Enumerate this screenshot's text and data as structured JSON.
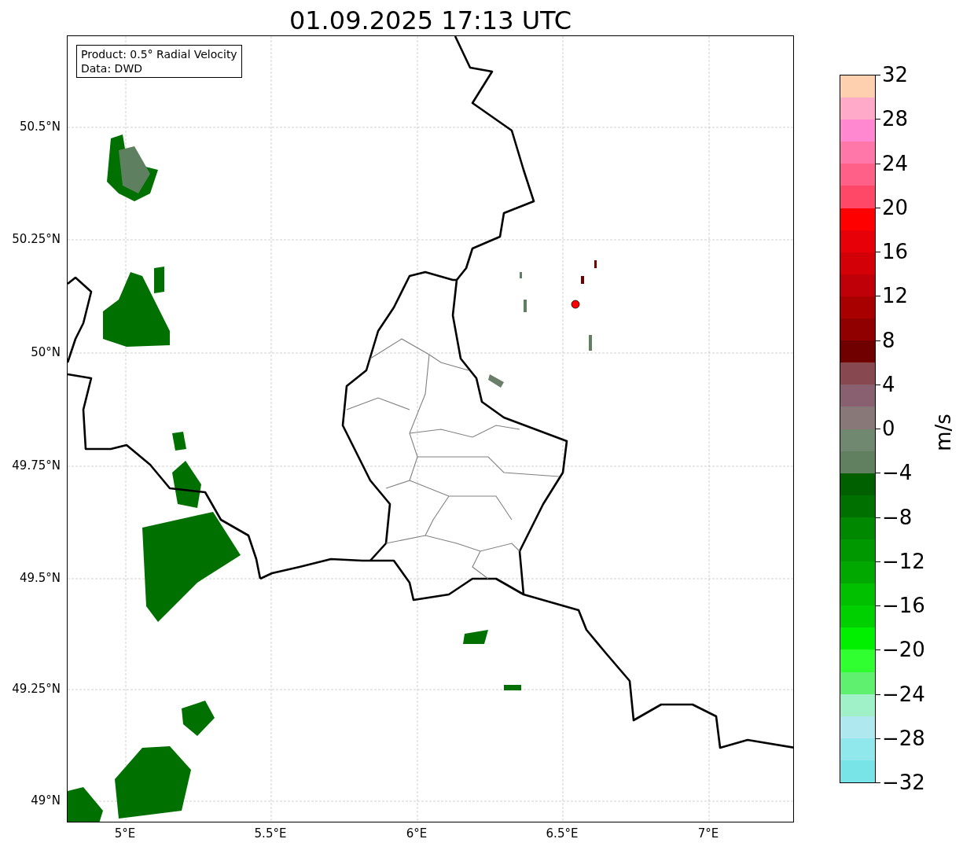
{
  "title": "01.09.2025 17:13 UTC",
  "info_box": [
    "Product: 0.5° Radial Velocity",
    "Data: DWD"
  ],
  "lat_labels": [
    "50.5°N",
    "50.25°N",
    "50°N",
    "49.75°N",
    "49.5°N",
    "49.25°N",
    "49°N"
  ],
  "lon_labels": [
    "5°E",
    "5.5°E",
    "6°E",
    "6.5°E",
    "7°E"
  ],
  "colorbar": {
    "label": "m/s",
    "ticks": [
      "32",
      "28",
      "24",
      "20",
      "16",
      "12",
      "8",
      "4",
      "0",
      "−4",
      "−8",
      "−12",
      "−16",
      "−20",
      "−24",
      "−28",
      "−32"
    ],
    "segments": [
      {
        "color": "#ffd0b0"
      },
      {
        "color": "#ffaac8"
      },
      {
        "color": "#ff88d0"
      },
      {
        "color": "#ff77a8"
      },
      {
        "color": "#ff6088"
      },
      {
        "color": "#ff4868"
      },
      {
        "color": "#ff0000"
      },
      {
        "color": "#e80008"
      },
      {
        "color": "#d40008"
      },
      {
        "color": "#c00008"
      },
      {
        "color": "#a80000"
      },
      {
        "color": "#900000"
      },
      {
        "color": "#700000"
      },
      {
        "color": "#884850"
      },
      {
        "color": "#886070"
      },
      {
        "color": "#887878"
      },
      {
        "color": "#708870"
      },
      {
        "color": "#608060"
      },
      {
        "color": "#006000"
      },
      {
        "color": "#007000"
      },
      {
        "color": "#008800"
      },
      {
        "color": "#009800"
      },
      {
        "color": "#00a800"
      },
      {
        "color": "#00c000"
      },
      {
        "color": "#00d000"
      },
      {
        "color": "#00f000"
      },
      {
        "color": "#30ff30"
      },
      {
        "color": "#60f070"
      },
      {
        "color": "#a0f0c8"
      },
      {
        "color": "#b0e8f0"
      },
      {
        "color": "#90e8ec"
      },
      {
        "color": "#78e4e8"
      }
    ]
  }
}
